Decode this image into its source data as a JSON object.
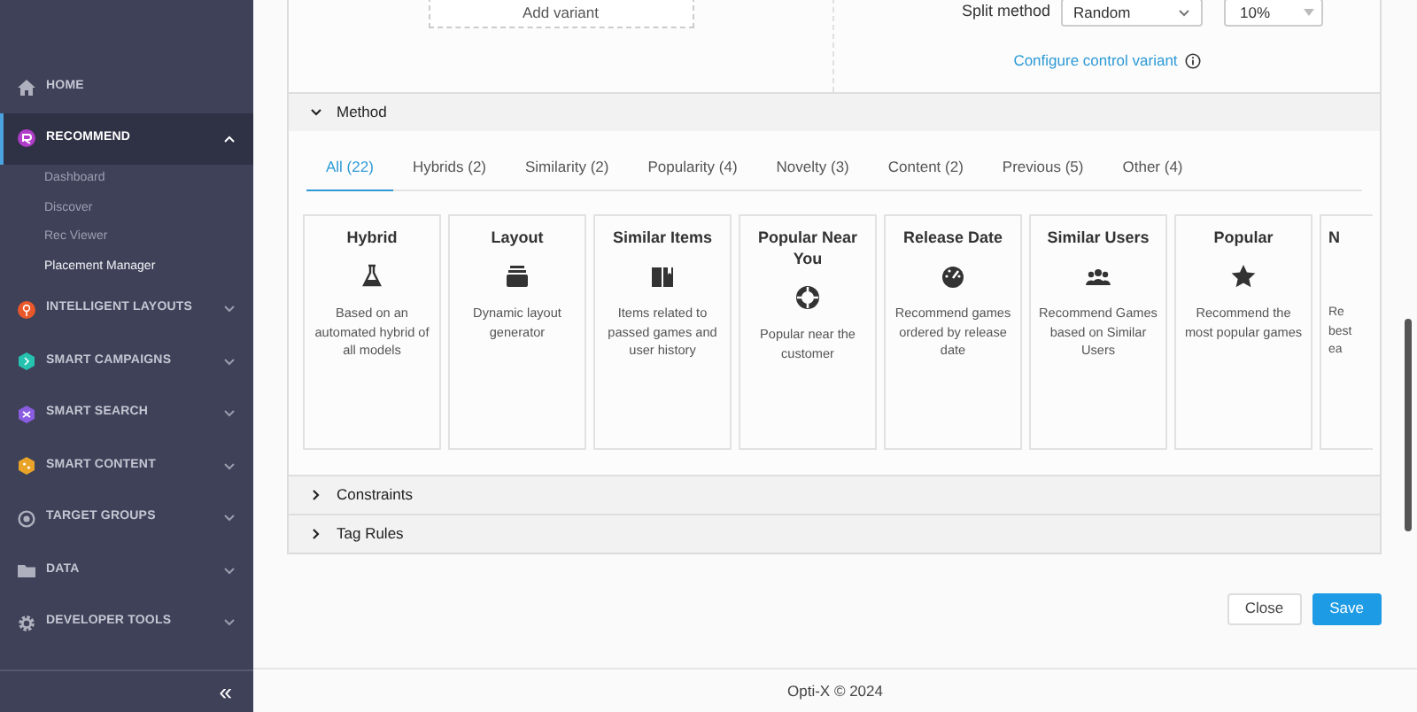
{
  "sidebar": {
    "items": [
      {
        "label": "HOME",
        "selected": false
      },
      {
        "label": "RECOMMEND",
        "selected": true,
        "expanded": true,
        "children": [
          {
            "label": "Dashboard",
            "selected": false
          },
          {
            "label": "Discover",
            "selected": false
          },
          {
            "label": "Rec Viewer",
            "selected": false
          },
          {
            "label": "Placement Manager",
            "selected": true
          }
        ]
      },
      {
        "label": "INTELLIGENT LAYOUTS",
        "selected": false,
        "expanded": false
      },
      {
        "label": "SMART CAMPAIGNS",
        "selected": false,
        "expanded": false
      },
      {
        "label": "SMART SEARCH",
        "selected": false,
        "expanded": false
      },
      {
        "label": "SMART CONTENT",
        "selected": false,
        "expanded": false
      },
      {
        "label": "TARGET GROUPS",
        "selected": false,
        "expanded": false
      },
      {
        "label": "DATA",
        "selected": false,
        "expanded": false
      },
      {
        "label": "DEVELOPER TOOLS",
        "selected": false,
        "expanded": false
      }
    ],
    "collapse": "«"
  },
  "variants": {
    "add_button": "Add variant",
    "split_label": "Split method",
    "split_value": "Random",
    "percent_value": "10%",
    "configure_link": "Configure control variant"
  },
  "sections": [
    {
      "title": "Method",
      "expanded": true,
      "tabs": [
        {
          "label": "All (22)",
          "selected": true
        },
        {
          "label": "Hybrids (2)",
          "selected": false
        },
        {
          "label": "Similarity (2)",
          "selected": false
        },
        {
          "label": "Popularity (4)",
          "selected": false
        },
        {
          "label": "Novelty (3)",
          "selected": false
        },
        {
          "label": "Content (2)",
          "selected": false
        },
        {
          "label": "Previous (5)",
          "selected": false
        },
        {
          "label": "Other (4)",
          "selected": false
        }
      ],
      "cards": [
        {
          "kind": "full",
          "title": "Hybrid",
          "description": "Based on an automated hybrid of all models"
        },
        {
          "kind": "full",
          "title": "Layout",
          "description": "Dynamic layout generator"
        },
        {
          "kind": "full",
          "title": "Similar Items",
          "description": "Items related to passed games and user history"
        },
        {
          "kind": "full",
          "title": "Popular Near You",
          "description": "Popular near the customer"
        },
        {
          "kind": "full",
          "title": "Release Date",
          "description": "Recommend games ordered by release date"
        },
        {
          "kind": "full",
          "title": "Similar Users",
          "description": "Recommend Games based on Similar Users"
        },
        {
          "kind": "full",
          "title": "Popular",
          "description": "Recommend the most popular games"
        },
        {
          "kind": "cut",
          "title": "N",
          "description": "Re best ea"
        }
      ]
    },
    {
      "title": "Constraints",
      "expanded": false
    },
    {
      "title": "Tag Rules",
      "expanded": false
    }
  ],
  "buttons": [
    {
      "label": "Close",
      "kind": "secondary"
    },
    {
      "label": "Save",
      "kind": "primary"
    }
  ],
  "footer": "Opti-X © 2024"
}
